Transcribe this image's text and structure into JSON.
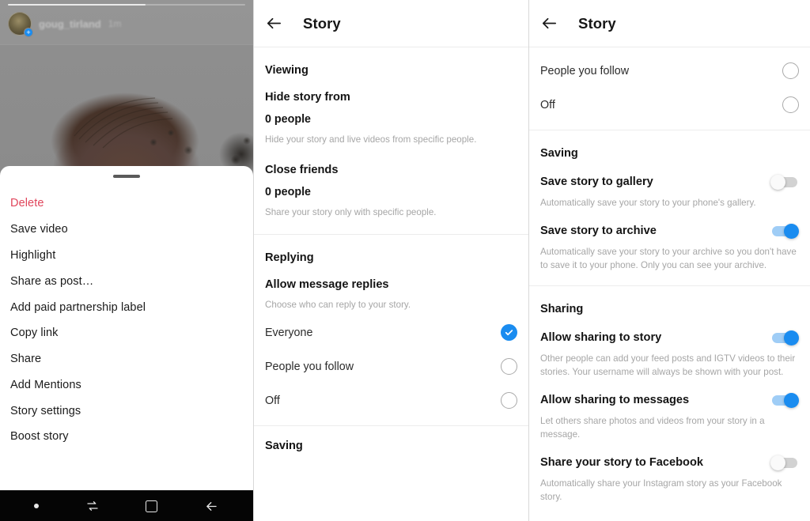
{
  "story_viewer": {
    "username": "goug_tirland",
    "timestamp": "1m",
    "avatar_badge_icon": "plus-badge-icon",
    "photo_alt": "blurred photo of a person's head",
    "sheet": {
      "handle_icon": "drag-handle-icon",
      "items": [
        {
          "label": "Delete",
          "style": "danger"
        },
        {
          "label": "Save video",
          "style": "normal"
        },
        {
          "label": "Highlight",
          "style": "normal"
        },
        {
          "label": "Share as post…",
          "style": "normal"
        },
        {
          "label": "Add paid partnership label",
          "style": "normal"
        },
        {
          "label": "Copy link",
          "style": "normal"
        },
        {
          "label": "Share",
          "style": "normal"
        },
        {
          "label": "Add Mentions",
          "style": "normal"
        },
        {
          "label": "Story settings",
          "style": "normal"
        },
        {
          "label": "Boost story",
          "style": "normal"
        }
      ]
    },
    "navbar": [
      {
        "name": "assistant-dot-icon",
        "label": ""
      },
      {
        "name": "recents-icon",
        "label": ""
      },
      {
        "name": "home-icon",
        "label": ""
      },
      {
        "name": "back-icon",
        "label": ""
      }
    ]
  },
  "panel_mid": {
    "appbar": {
      "back_icon": "back-arrow-icon",
      "title": "Story"
    },
    "viewing": {
      "section_title": "Viewing",
      "hide_story_from": {
        "title": "Hide story from",
        "value": "0 people",
        "subtitle": "Hide your story and live videos from specific people."
      },
      "close_friends": {
        "title": "Close friends",
        "value": "0 people",
        "subtitle": "Share your story only with specific people."
      }
    },
    "replying": {
      "section_title": "Replying",
      "allow_message_replies": {
        "title": "Allow message replies",
        "subtitle": "Choose who can reply to your story."
      },
      "options": [
        {
          "label": "Everyone",
          "selected": true
        },
        {
          "label": "People you follow",
          "selected": false
        },
        {
          "label": "Off",
          "selected": false
        }
      ]
    },
    "saving_section_title": "Saving"
  },
  "panel_right": {
    "appbar": {
      "back_icon": "back-arrow-icon",
      "title": "Story"
    },
    "reply_options": [
      {
        "label": "People you follow",
        "selected": false
      },
      {
        "label": "Off",
        "selected": false
      }
    ],
    "saving": {
      "section_title": "Saving",
      "rows": [
        {
          "title": "Save story to gallery",
          "subtitle": "Automatically save your story to your phone's gallery.",
          "enabled": false
        },
        {
          "title": "Save story to archive",
          "subtitle": "Automatically save your story to your archive so you don't have to save it to your phone. Only you can see your archive.",
          "enabled": true
        }
      ]
    },
    "sharing": {
      "section_title": "Sharing",
      "rows": [
        {
          "title": "Allow sharing to story",
          "subtitle": "Other people can add your feed posts and IGTV videos to their stories. Your username will always be shown with your post.",
          "enabled": true
        },
        {
          "title": "Allow sharing to messages",
          "subtitle": "Let others share photos and videos from your story in a message.",
          "enabled": true
        },
        {
          "title": "Share your story to Facebook",
          "subtitle": "Automatically share your Instagram story as your Facebook story.",
          "enabled": false
        }
      ]
    }
  },
  "colors": {
    "accent_blue": "#1a8cf0",
    "toggle_on_track": "#9fcdf6",
    "danger_red": "#e0455b",
    "subtitle_gray": "#a6a6a6",
    "navbar_black": "#050505"
  }
}
